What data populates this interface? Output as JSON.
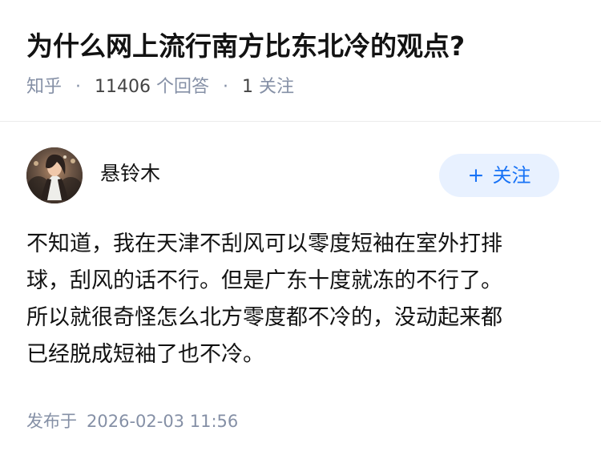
{
  "question": {
    "title": "为什么网上流行南方比东北冷的观点?",
    "source": "知乎",
    "answer_count": "11406",
    "answer_label": "个回答",
    "follow_count": "1",
    "follow_label": "关注"
  },
  "author": {
    "name": "悬铃木"
  },
  "follow_button": {
    "icon": "plus-icon",
    "label": "关注"
  },
  "answer": {
    "lines": [
      "不知道，我在天津不刮风可以零度短袖在室外打排",
      "球，刮风的话不行。但是广东十度就冻的不行了。",
      "所以就很奇怪怎么北方零度都不冷的，没动起来都",
      "已经脱成短袖了也不冷。"
    ]
  },
  "publish": {
    "label": "发布于",
    "time": "2026-02-03 11:56"
  },
  "colors": {
    "primary_text": "#121212",
    "meta_text": "#8590a6",
    "follow_text": "#1772f6",
    "follow_background": "#e8f1ff"
  }
}
